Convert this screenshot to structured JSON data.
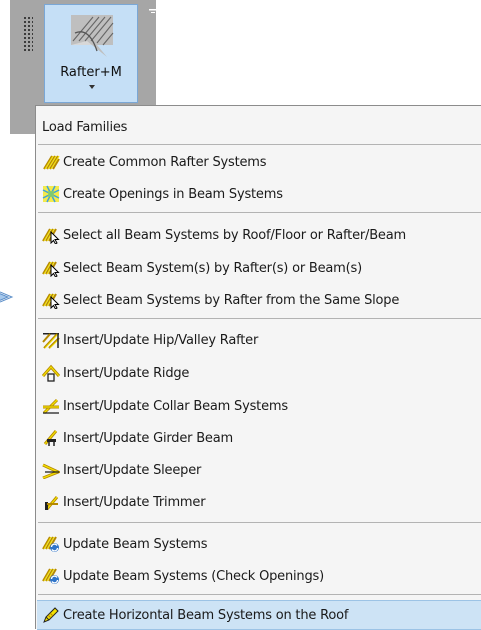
{
  "ribbon": {
    "button_label": "Rafter+M",
    "icon": "rafter-pattern-icon"
  },
  "menu": {
    "load_families": "Load Families",
    "groups": [
      [
        "Create Common Rafter Systems",
        "Create Openings in Beam Systems"
      ],
      [
        "Select all Beam Systems by Roof/Floor or Rafter/Beam",
        "Select Beam System(s) by Rafter(s) or Beam(s)",
        "Select Beam Systems by Rafter from the Same Slope"
      ],
      [
        "Insert/Update Hip/Valley Rafter",
        "Insert/Update Ridge",
        "Insert/Update Collar Beam Systems",
        "Insert/Update Girder Beam",
        "Insert/Update Sleeper",
        "Insert/Update Trimmer"
      ],
      [
        "Update Beam Systems",
        "Update Beam Systems (Check Openings)"
      ],
      [
        "Create Horizontal Beam Systems on the Roof"
      ]
    ]
  },
  "colors": {
    "highlight": "#cde3f5",
    "icon_yellow": "#e8d800",
    "icon_blue": "#2f74c9"
  }
}
